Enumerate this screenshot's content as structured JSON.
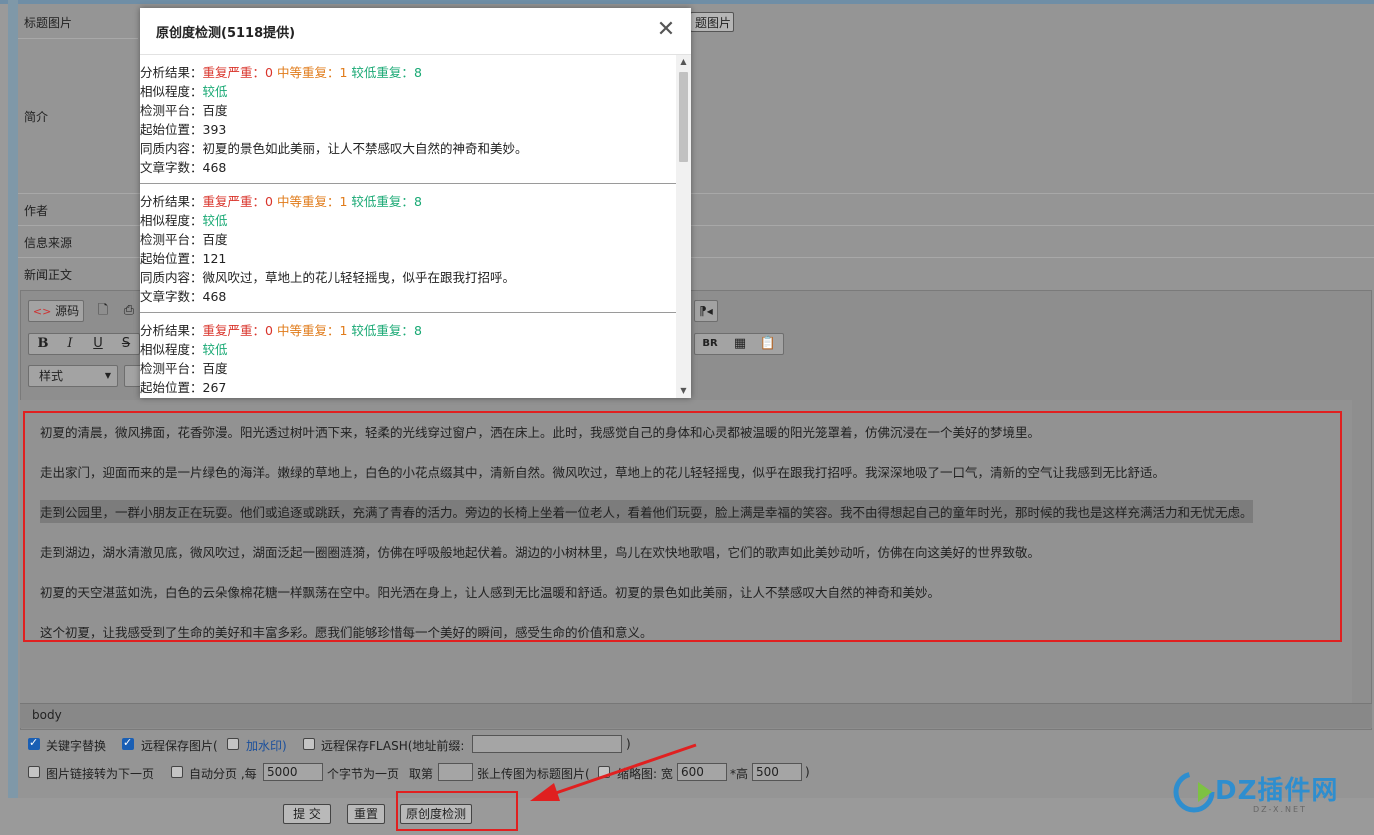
{
  "form": {
    "labels": {
      "title_image": "标题图片",
      "summary": "简介",
      "author": "作者",
      "source": "信息来源",
      "body": "新闻正文"
    },
    "title_image_button": "题图片"
  },
  "toolbar": {
    "source_label": "源码",
    "style_select": "样式",
    "bold": "B",
    "italic": "I",
    "underline": "U",
    "strike": "S"
  },
  "editor": {
    "paragraphs": [
      "初夏的清晨，微风拂面，花香弥漫。阳光透过树叶洒下来，轻柔的光线穿过窗户，洒在床上。此时，我感觉自己的身体和心灵都被温暖的阳光笼罩着，仿佛沉浸在一个美好的梦境里。",
      "走出家门，迎面而来的是一片绿色的海洋。嫩绿的草地上，白色的小花点缀其中，清新自然。微风吹过，草地上的花儿轻轻摇曳，似乎在跟我打招呼。我深深地吸了一口气，清新的空气让我感到无比舒适。",
      "走到公园里，一群小朋友正在玩耍。他们或追逐或跳跃，充满了青春的活力。旁边的长椅上坐着一位老人，看着他们玩耍，脸上满是幸福的笑容。我不由得想起自己的童年时光，那时候的我也是这样充满活力和无忧无虑。",
      "走到湖边，湖水清澈见底，微风吹过，湖面泛起一圈圈涟漪，仿佛在呼吸般地起伏着。湖边的小树林里，鸟儿在欢快地歌唱，它们的歌声如此美妙动听，仿佛在向这美好的世界致敬。",
      "初夏的天空湛蓝如洗，白色的云朵像棉花糖一样飘荡在空中。阳光洒在身上，让人感到无比温暖和舒适。初夏的景色如此美丽，让人不禁感叹大自然的神奇和美妙。",
      "这个初夏，让我感受到了生命的美好和丰富多彩。愿我们能够珍惜每一个美好的瞬间，感受生命的价值和意义。"
    ],
    "status_tag": "body"
  },
  "options": {
    "keyword_replace": "关键字替换",
    "remote_save_images": "远程保存图片(",
    "watermark": "加水印)",
    "remote_save_flash": "远程保存FLASH(地址前缀:",
    "flash_close": ")",
    "image_link_next": "图片链接转为下一页",
    "auto_paging": "自动分页 ,每",
    "chars_per_page_value": "5000",
    "chars_per_page_suffix": "个字节为一页",
    "take_nth": "取第",
    "upload_as_title": "张上传图为标题图片(",
    "thumbnail": "缩略图: 宽",
    "thumb_width": "600",
    "thumb_height_label": "*高",
    "thumb_height": "500",
    "close_paren": ")"
  },
  "buttons": {
    "submit": "提 交",
    "reset": "重置",
    "originality_check": "原创度检测"
  },
  "modal": {
    "title": "原创度检测(5118提供)",
    "labels": {
      "analysis": "分析结果：",
      "severe": "重复严重：",
      "medium": "中等重复：",
      "low": "较低重复：",
      "similarity": "相似程度：",
      "platform": "检测平台：",
      "start_pos": "起始位置：",
      "same_content": "同质内容：",
      "word_count": "文章字数："
    },
    "results": [
      {
        "severe": "0",
        "medium": "1",
        "low": "8",
        "similarity": "较低",
        "platform": "百度",
        "start": "393",
        "content": "初夏的景色如此美丽，让人不禁感叹大自然的神奇和美妙。",
        "words": "468"
      },
      {
        "severe": "0",
        "medium": "1",
        "low": "8",
        "similarity": "较低",
        "platform": "百度",
        "start": "121",
        "content": "微风吹过，草地上的花儿轻轻摇曳，似乎在跟我打招呼。",
        "words": "468"
      },
      {
        "severe": "0",
        "medium": "1",
        "low": "8",
        "similarity": "较低",
        "platform": "百度",
        "start": "267"
      }
    ]
  },
  "watermark": {
    "brand": "DZ插件网",
    "sub": "DZ-X.NET"
  },
  "colors": {
    "severe": "#d9342b",
    "medium": "#e07b1a",
    "low": "#19a974",
    "highlight_box": "#e02020"
  }
}
